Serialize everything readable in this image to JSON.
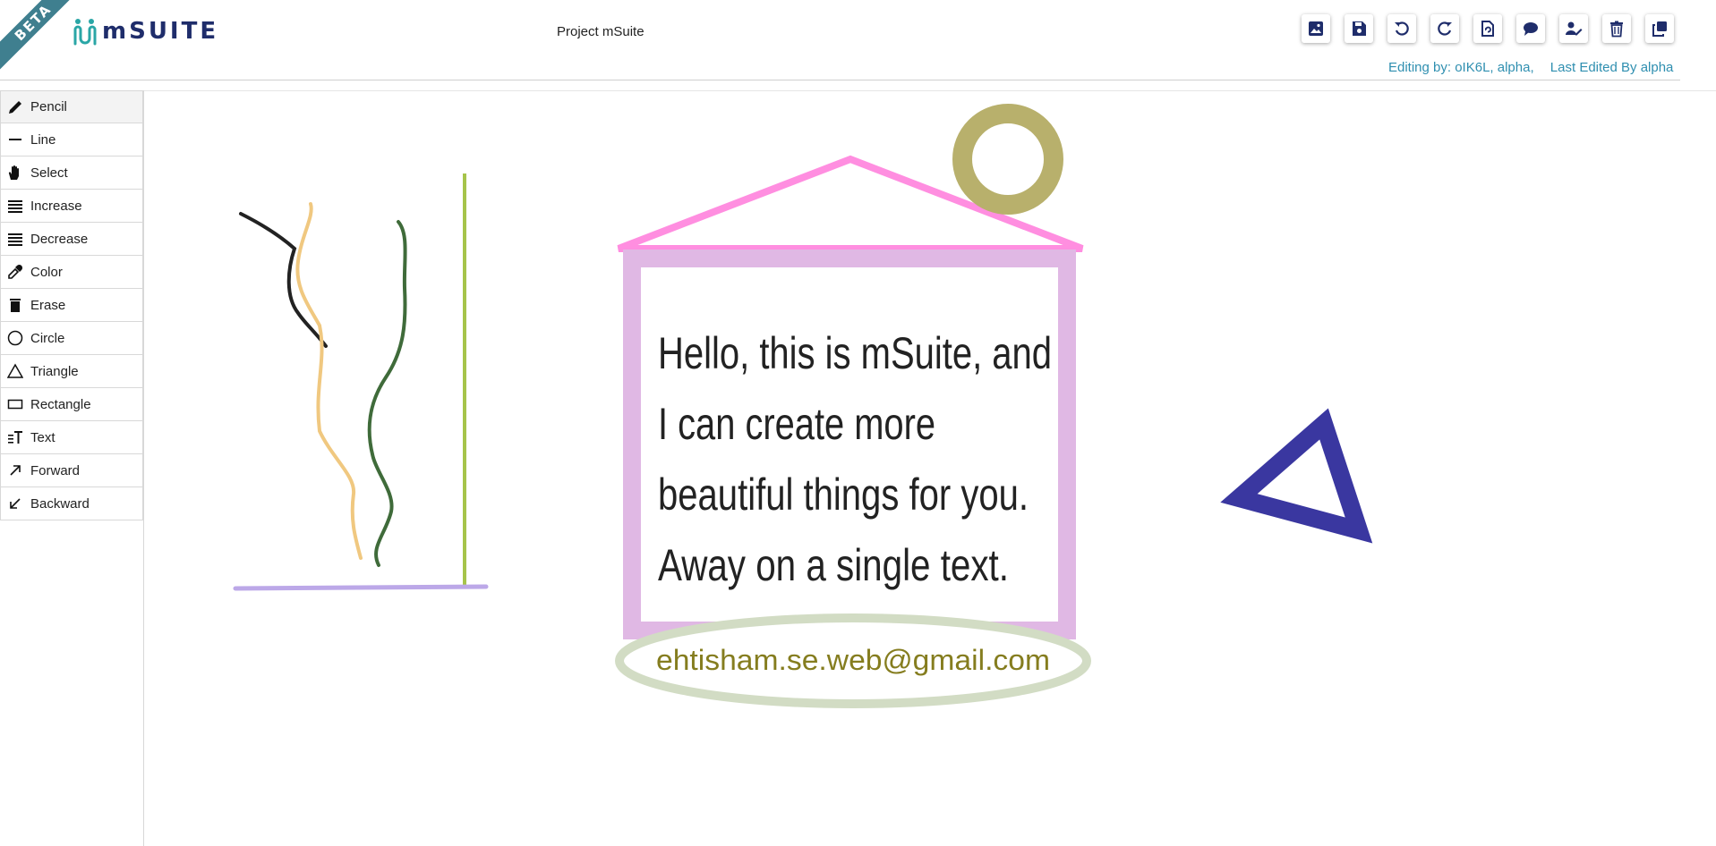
{
  "header": {
    "beta_label": "BETA",
    "logo_text": "mSUITE",
    "project_title": "Project mSuite",
    "editing_by": "Editing by: oIK6L, alpha,",
    "last_edited": "Last Edited By alpha"
  },
  "toolbar": [
    {
      "name": "image-icon"
    },
    {
      "name": "save-icon"
    },
    {
      "name": "undo-icon"
    },
    {
      "name": "redo-icon"
    },
    {
      "name": "copy-file-icon"
    },
    {
      "name": "comment-icon"
    },
    {
      "name": "user-edit-icon"
    },
    {
      "name": "trash-icon"
    },
    {
      "name": "clone-icon"
    }
  ],
  "sidebar": {
    "tools": [
      {
        "label": "Pencil",
        "icon": "pencil-icon"
      },
      {
        "label": "Line",
        "icon": "line-icon"
      },
      {
        "label": "Select",
        "icon": "hand-icon"
      },
      {
        "label": "Increase",
        "icon": "bars-icon"
      },
      {
        "label": "Decrease",
        "icon": "bars-icon"
      },
      {
        "label": "Color",
        "icon": "eyedropper-icon"
      },
      {
        "label": "Erase",
        "icon": "trash-icon"
      },
      {
        "label": "Circle",
        "icon": "circle-icon"
      },
      {
        "label": "Triangle",
        "icon": "triangle-icon"
      },
      {
        "label": "Rectangle",
        "icon": "rectangle-icon"
      },
      {
        "label": "Text",
        "icon": "text-icon"
      },
      {
        "label": "Forward",
        "icon": "arrow-up-right-icon"
      },
      {
        "label": "Backward",
        "icon": "arrow-down-left-icon"
      }
    ]
  },
  "canvas": {
    "text_lines": [
      "Hello, this is mSuite, and",
      "I can create more",
      "beautiful things for you.",
      "Away on a single text."
    ],
    "email": "ehtisham.se.web@gmail.com",
    "colors": {
      "roof": "#ff8ee0",
      "frame": "#e0b8e4",
      "ring": "#b8b06c",
      "triangle": "#3a37a0",
      "ellipse": "#d2dcc4",
      "email_text": "#857d1f",
      "stroke_black": "#222222",
      "stroke_tan": "#f0c880",
      "stroke_green": "#3f6b3a",
      "stroke_lime": "#a6c44a",
      "stroke_lavender": "#bca8e8"
    }
  }
}
